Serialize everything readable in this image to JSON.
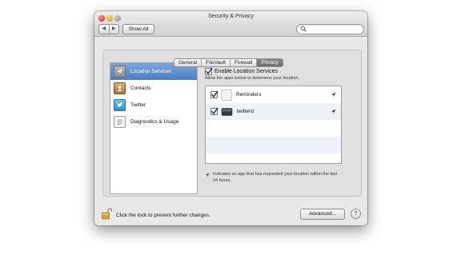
{
  "window": {
    "title": "Security & Privacy"
  },
  "toolbar": {
    "back_label": "◀",
    "forward_label": "▶",
    "show_all_label": "Show All",
    "search_value": "",
    "search_placeholder": ""
  },
  "tabs": [
    {
      "label": "General",
      "active": false
    },
    {
      "label": "FileVault",
      "active": false
    },
    {
      "label": "Firewall",
      "active": false
    },
    {
      "label": "Privacy",
      "active": true
    }
  ],
  "sidebar": {
    "items": [
      {
        "label": "Location Services",
        "icon": "location-services-icon",
        "selected": true
      },
      {
        "label": "Contacts",
        "icon": "contacts-icon",
        "selected": false
      },
      {
        "label": "Twitter",
        "icon": "twitter-icon",
        "selected": false
      },
      {
        "label": "Diagnostics & Usage",
        "icon": "diagnostics-icon",
        "selected": false
      }
    ]
  },
  "location": {
    "enable_label": "Enable Location Services",
    "enable_checked": true,
    "subtitle": "Allow the apps below to determine your location.",
    "apps": [
      {
        "name": "Reminders",
        "checked": true,
        "icon": "reminders-icon",
        "recent": true
      },
      {
        "name": "twitterd",
        "checked": true,
        "icon": "twitterd-icon",
        "recent": true
      }
    ],
    "note": "Indicates an app that has requested your location within the last 24 hours."
  },
  "footer": {
    "lock_text": "Click the lock to prevent further changes.",
    "advanced_label": "Advanced...",
    "help_label": "?"
  },
  "colors": {
    "selection_blue": "#4c7cc4",
    "window_bg": "#e8e8e8"
  }
}
